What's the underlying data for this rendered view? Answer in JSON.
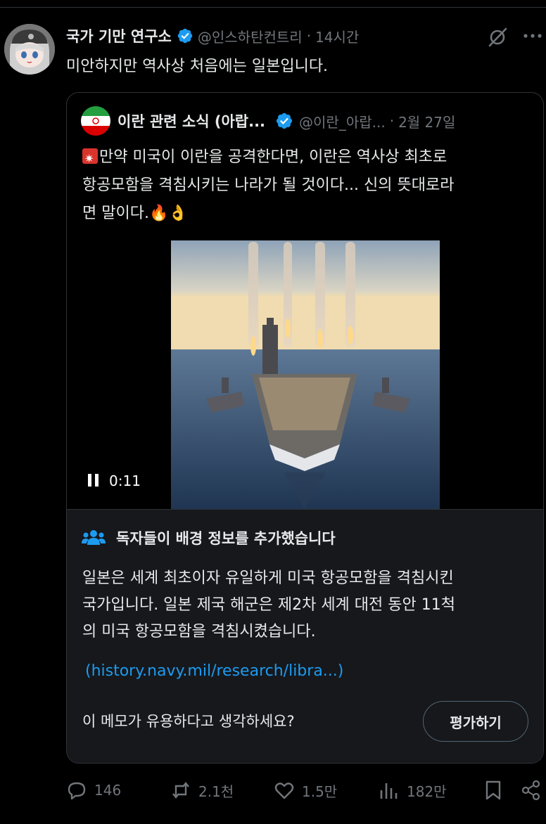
{
  "post": {
    "author_name": "국가 기만 연구소",
    "handle": "@인스하탄컨트리",
    "separator": "·",
    "time": "14시간",
    "text": "미안하지만 역사상 처음에는 일본입니다."
  },
  "quote": {
    "author_name": "이란 관련 소식 (아랍...",
    "handle": "@이란_아랍...",
    "separator": "·",
    "date": "2월 27일",
    "body_lines": [
      "만약 미국이 이란을 공격한다면, 이란은 역사상 최초로",
      "항공모함을 격침시키는 나라가 될 것이다... 신의 뜻대로라",
      "면 말이다.🔥👌"
    ],
    "video_time": "0:11"
  },
  "community_note": {
    "title": "독자들이 배경 정보를 추가했습니다",
    "body_lines": [
      "일본은 세계 최초이자 유일하게 미국 항공모함을 격침시킨",
      "국가입니다. 일본 제국 해군은 제2차 세계 대전 동안 11척",
      "의 미국 항공모함을 격침시켰습니다."
    ],
    "link": "(history.navy.mil/research/libra...)",
    "question": "이 메모가 유용하다고 생각하세요?",
    "rate_button": "평가하기"
  },
  "actions": {
    "replies": "146",
    "reposts": "2.1천",
    "likes": "1.5만",
    "views": "182만"
  },
  "icons": {
    "verified": "verified-badge-icon",
    "grok": "grok-icon",
    "more": "more-icon",
    "reply": "reply-icon",
    "repost": "repost-icon",
    "like": "heart-icon",
    "views": "views-icon",
    "bookmark": "bookmark-icon",
    "share": "share-icon",
    "people": "people-icon",
    "pause": "pause-icon"
  },
  "colors": {
    "background": "#000000",
    "text": "#e7e9ea",
    "muted": "#71767b",
    "accent": "#1d9bf0",
    "note_bg": "#16181c",
    "border": "#2f3336"
  }
}
